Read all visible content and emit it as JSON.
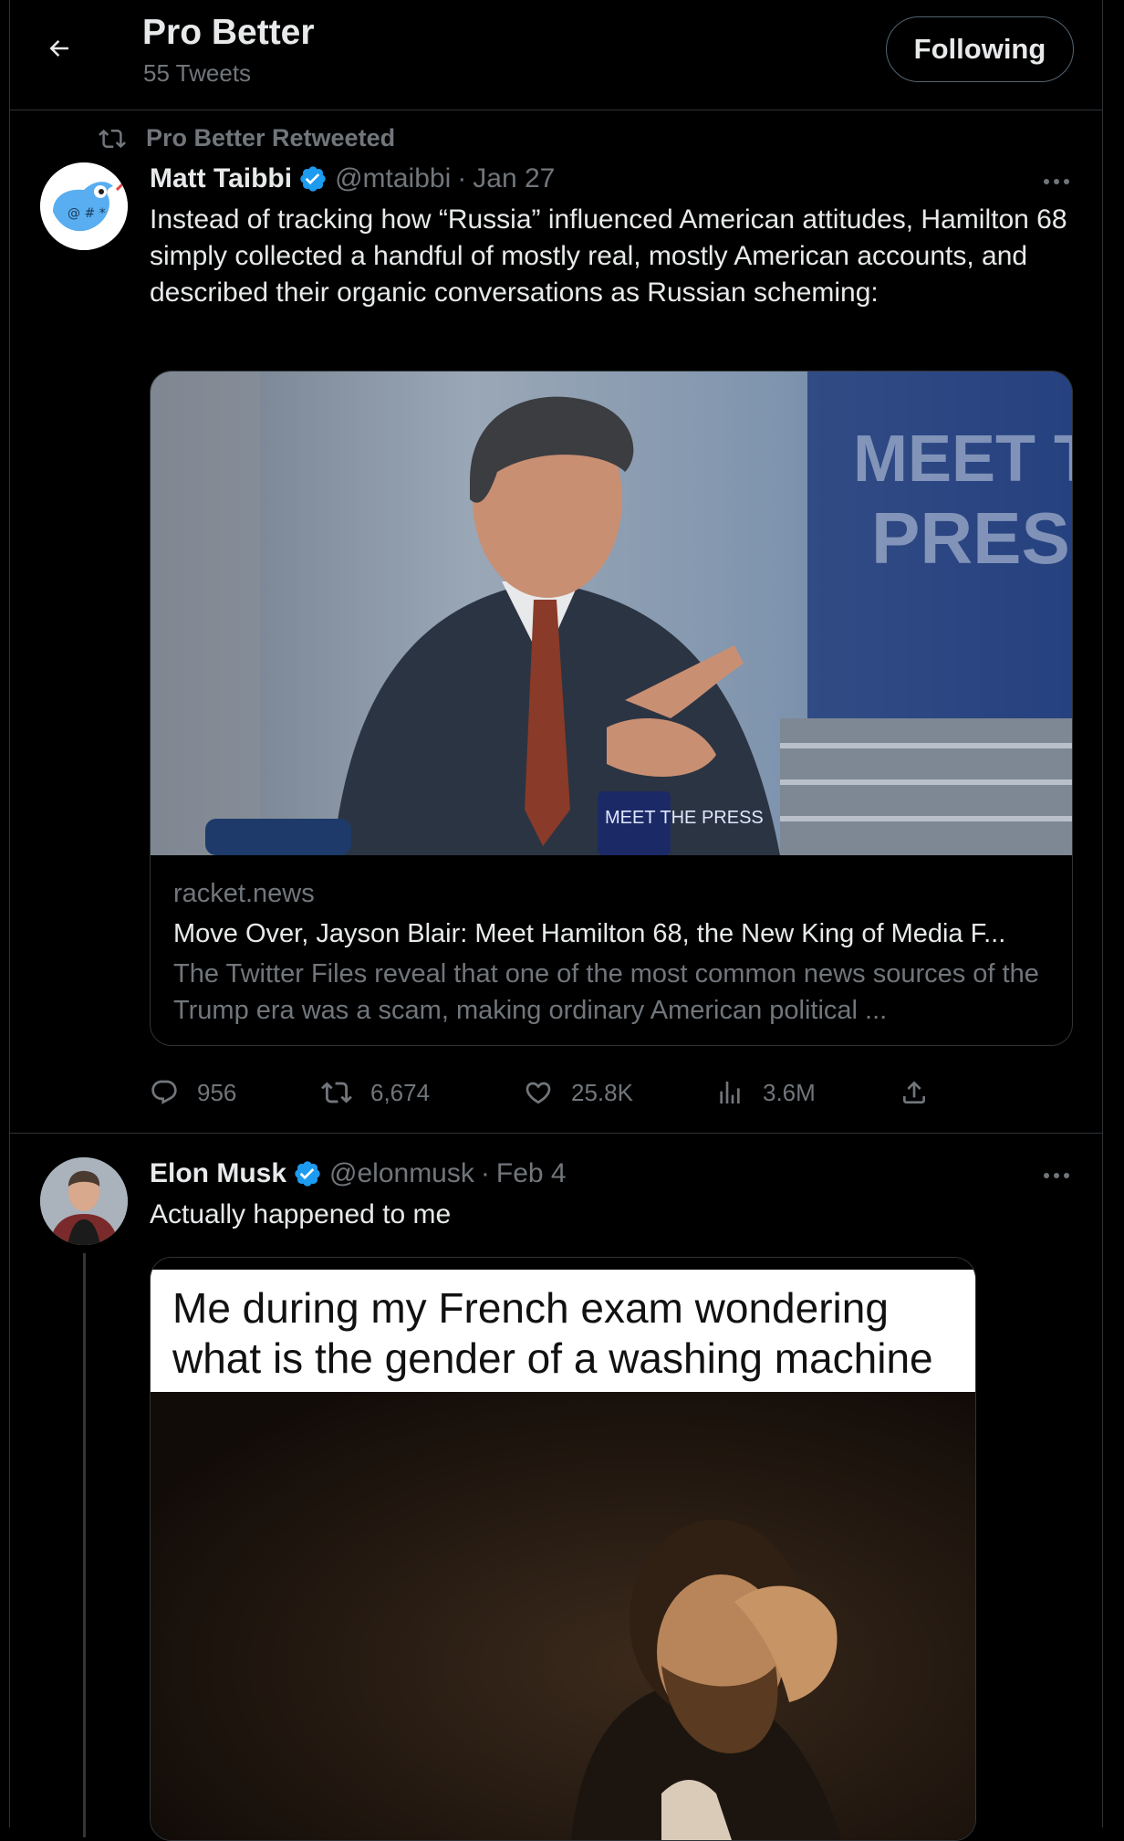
{
  "header": {
    "title": "Pro Better",
    "subtitle": "55 Tweets",
    "follow_label": "Following"
  },
  "tweets": [
    {
      "retweet_label": "Pro Better Retweeted",
      "name": "Matt Taibbi",
      "handle": "@mtaibbi",
      "separator": "·",
      "date": "Jan 27",
      "text": "Instead of tracking how “Russia” influenced American attitudes, Hamilton 68 simply collected a handful of mostly real, mostly American accounts, and described their organic conversations as Russian scheming:",
      "card": {
        "domain": "racket.news",
        "title": "Move Over, Jayson Blair: Meet Hamilton 68, the New King of Media F...",
        "description": "The Twitter Files reveal that one of the most common news sources of the Trump era was a scam, making ordinary American political ...",
        "image_text_line1": "MEET THE",
        "image_text_line2": "PRESS",
        "mug_text": "MEET THE PRESS"
      },
      "stats": {
        "replies": "956",
        "retweets": "6,674",
        "likes": "25.8K",
        "views": "3.6M"
      }
    },
    {
      "name": "Elon Musk",
      "handle": "@elonmusk",
      "separator": "·",
      "date": "Feb 4",
      "text": "Actually happened to me",
      "meme_caption": "Me during my French exam wondering what is the gender of a washing machine"
    }
  ],
  "colors": {
    "background": "#000000",
    "text_primary": "#e7e9ea",
    "text_secondary": "#71767b",
    "border": "#2f3336",
    "verified_blue": "#1d9bf0"
  }
}
